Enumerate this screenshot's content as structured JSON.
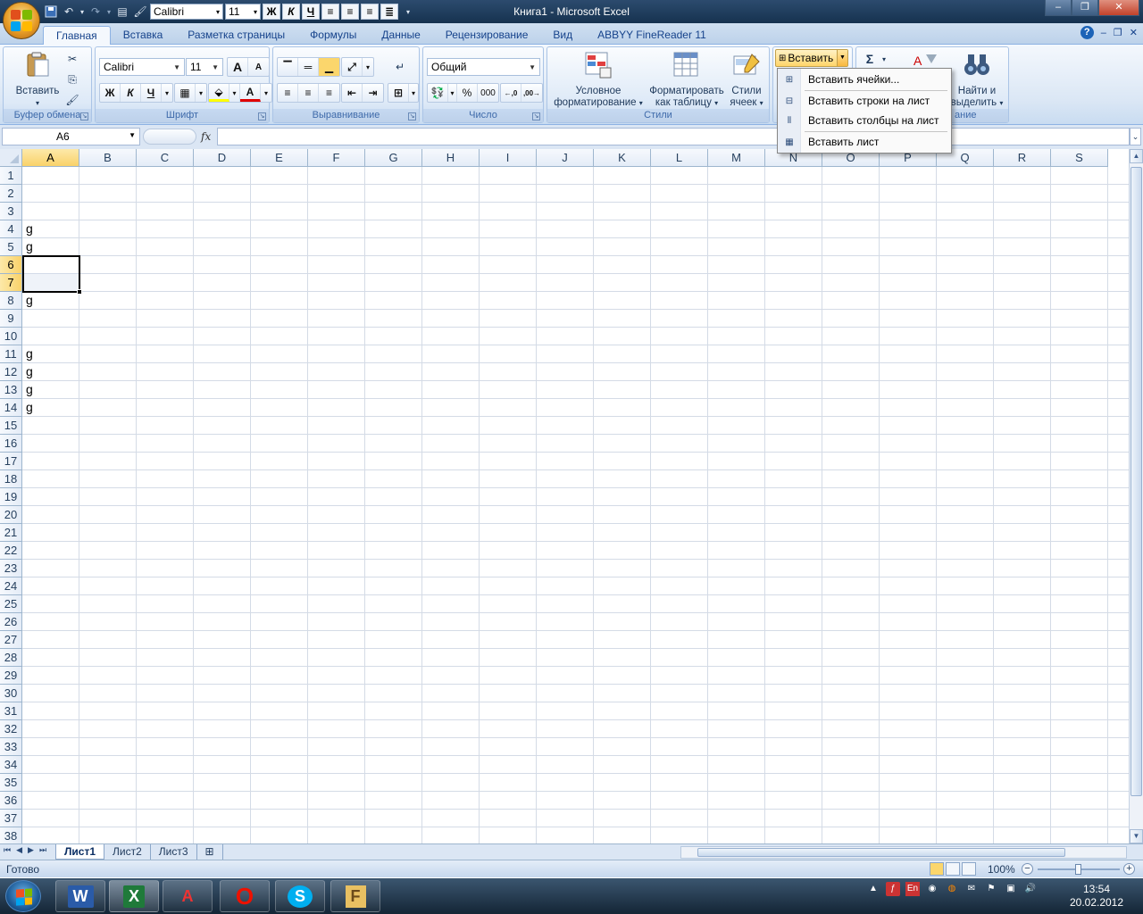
{
  "window": {
    "title": "Книга1 - Microsoft Excel",
    "controls": [
      "‒",
      "❐",
      "✕"
    ]
  },
  "qat": {
    "font": "Calibri",
    "size": "11",
    "bold": "Ж",
    "italic": "К",
    "underline": "Ч"
  },
  "tabs": [
    "Главная",
    "Вставка",
    "Разметка страницы",
    "Формулы",
    "Данные",
    "Рецензирование",
    "Вид",
    "ABBYY FineReader 11"
  ],
  "ribbon": {
    "clipboard": {
      "paste": "Вставить",
      "label": "Буфер обмена"
    },
    "font": {
      "name": "Calibri",
      "size": "11",
      "bold": "Ж",
      "italic": "К",
      "underline": "Ч",
      "grow": "A",
      "shrink": "A",
      "label": "Шрифт"
    },
    "alignment": {
      "label": "Выравнивание"
    },
    "number": {
      "format": "Общий",
      "percent": "%",
      "thousands": "000",
      "label": "Число"
    },
    "styles": {
      "conditional": "Условное форматирование",
      "conditional_l1": "Условное",
      "conditional_l2": "форматирование",
      "table_l1": "Форматировать",
      "table_l2": "как таблицу",
      "cell_l1": "Стили",
      "cell_l2": "ячеек",
      "label": "Стили"
    },
    "cells": {
      "insert": "Вставить"
    },
    "editing": {
      "sum": "Σ",
      "find_l1": "Найти и",
      "find_l2": "выделить",
      "label_partial": "ание"
    }
  },
  "insert_menu": {
    "items": [
      "Вставить ячейки...",
      "Вставить строки на лист",
      "Вставить столбцы на лист",
      "Вставить лист"
    ]
  },
  "formula_bar": {
    "name_box": "A6",
    "fx": "fx",
    "formula": ""
  },
  "grid": {
    "columns": [
      "A",
      "B",
      "C",
      "D",
      "E",
      "F",
      "G",
      "H",
      "I",
      "J",
      "K",
      "L",
      "M",
      "N",
      "O",
      "P",
      "Q",
      "R",
      "S"
    ],
    "rows": [
      "1",
      "2",
      "3",
      "4",
      "5",
      "6",
      "7",
      "8",
      "9",
      "10",
      "11",
      "12",
      "13",
      "14",
      "15",
      "16",
      "17",
      "18",
      "19",
      "20",
      "21",
      "22",
      "23",
      "24",
      "25",
      "26",
      "27",
      "28",
      "29",
      "30",
      "31",
      "32",
      "33",
      "34",
      "35",
      "36",
      "37",
      "38"
    ],
    "selected_column": "A",
    "selected_rows": [
      "6",
      "7"
    ],
    "cells": [
      {
        "ref": "A4",
        "value": "g"
      },
      {
        "ref": "A5",
        "value": "g"
      },
      {
        "ref": "A8",
        "value": "g"
      },
      {
        "ref": "A11",
        "value": "g"
      },
      {
        "ref": "A12",
        "value": "g"
      },
      {
        "ref": "A13",
        "value": "g"
      },
      {
        "ref": "A14",
        "value": "g"
      }
    ]
  },
  "sheets": {
    "tabs": [
      "Лист1",
      "Лист2",
      "Лист3"
    ],
    "active": "Лист1"
  },
  "status": {
    "text": "Готово",
    "zoom": "100%"
  },
  "taskbar": {
    "apps": [
      "W",
      "X",
      "A",
      "O",
      "S",
      "F"
    ],
    "lang": "En",
    "time": "13:54",
    "date": "20.02.2012"
  }
}
